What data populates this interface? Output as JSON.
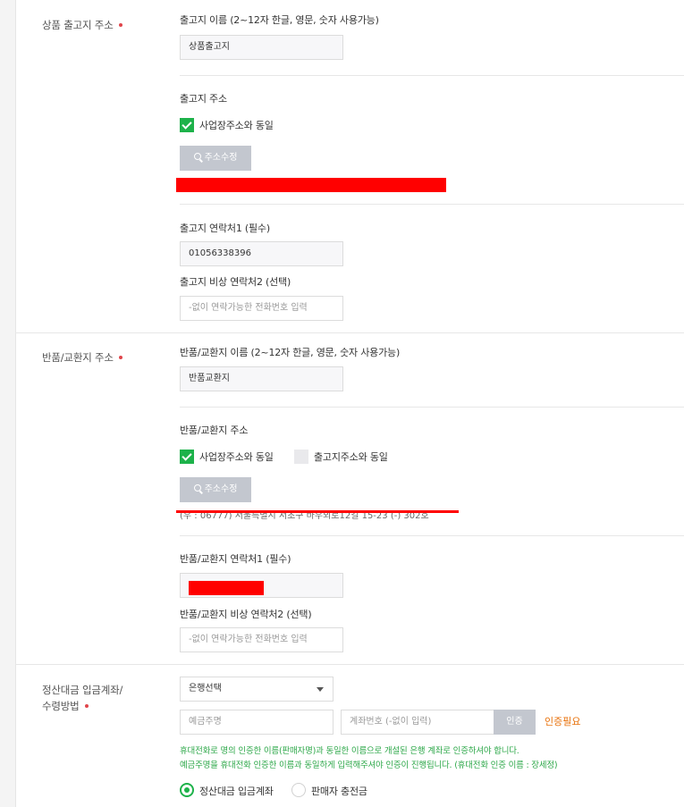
{
  "shipping": {
    "section_label": "상품 출고지 주소",
    "name_label": "출고지 이름 (2~12자 한글, 영문, 숫자 사용가능)",
    "name_value": "상품출고지",
    "address_label": "출고지 주소",
    "same_as_business": "사업장주소와 동일",
    "address_button": "주소수정",
    "contact1_label": "출고지 연락처1 (필수)",
    "contact1_value": "01056338396",
    "contact2_label": "출고지 비상 연락처2 (선택)",
    "contact2_placeholder": "-없이 연락가능한 전화번호 입력"
  },
  "returns": {
    "section_label": "반품/교환지 주소",
    "name_label": "반품/교환지 이름 (2~12자 한글, 영문, 숫자 사용가능)",
    "name_value": "반품교환지",
    "address_label": "반품/교환지 주소",
    "same_as_business": "사업장주소와 동일",
    "same_as_shipping": "출고지주소와 동일",
    "address_button": "주소수정",
    "address_text": "(우 : 06777) 서울특별시 서초구 바우뫼로12길 15-23 (-) 302호",
    "contact1_label": "반품/교환지 연락처1 (필수)",
    "contact2_label": "반품/교환지 비상 연락처2 (선택)",
    "contact2_placeholder": "-없이 연락가능한 전화번호 입력"
  },
  "settlement": {
    "section_label_1": "정산대금 입금계좌/",
    "section_label_2": "수령방법",
    "bank_select": "은행선택",
    "holder_placeholder": "예금주명",
    "account_placeholder": "계좌번호 (-없이 입력)",
    "verify_button": "인증",
    "verify_status": "인증필요",
    "notice_1": "휴대전화로 명의 인증한 이름(판매자명)과 동일한 이름으로 개설된 은행 계좌로 인증하셔야 합니다.",
    "notice_2": "예금주명을 휴대전화 인증한 이름과 동일하게 입력해주셔야 인증이 진행됩니다. (휴대전화 인증 이름 : 장세정)",
    "option_account": "정산대금 입금계좌",
    "option_charge": "판매자 충전금"
  },
  "colors": {
    "accent_green": "#1db24a",
    "required_dot": "#e0454b",
    "warning_orange": "#e8720c",
    "notice_green": "#2ea84a"
  }
}
